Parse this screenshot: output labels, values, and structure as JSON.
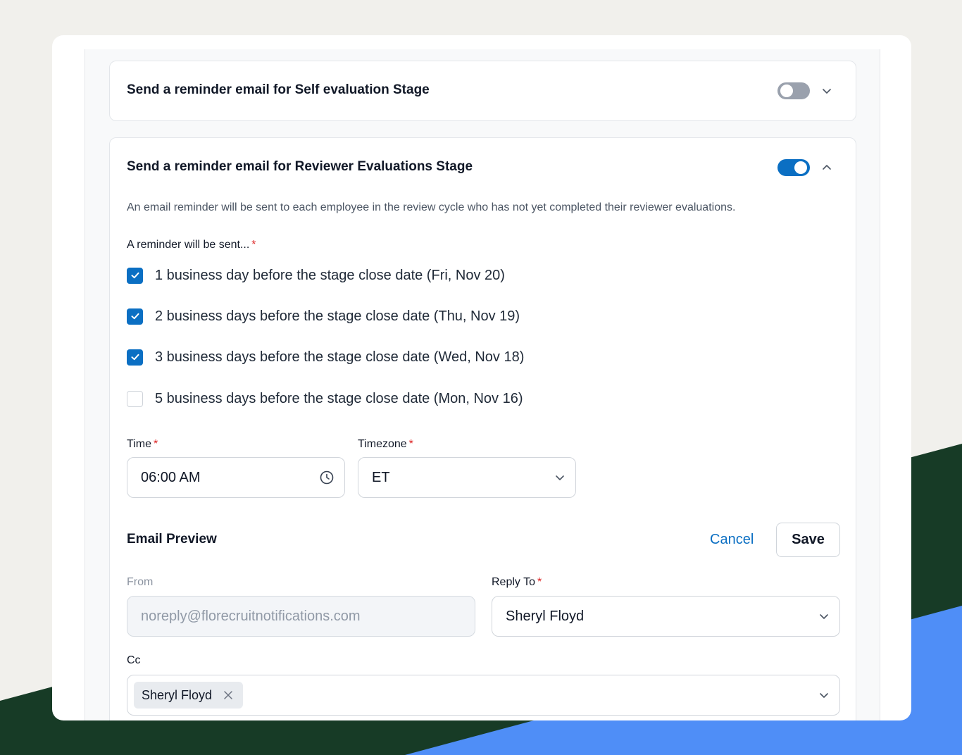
{
  "self_stage": {
    "title": "Send a reminder email for Self evaluation Stage",
    "toggle_on": false,
    "chevron_icon": "chevron-down-icon"
  },
  "reviewer_stage": {
    "title": "Send a reminder email for Reviewer Evaluations Stage",
    "toggle_on": true,
    "chevron_icon": "chevron-up-icon",
    "description": "An email reminder will be sent to each employee in the review cycle who has not yet completed their reviewer evaluations.",
    "reminder_label": "A reminder will be sent...",
    "required_mark": "*",
    "options": [
      {
        "label": "1 business day before the stage close date (Fri, Nov 20)",
        "checked": true
      },
      {
        "label": "2 business days before the stage close date (Thu, Nov 19)",
        "checked": true
      },
      {
        "label": "3 business days before the stage close date (Wed, Nov 18)",
        "checked": true
      },
      {
        "label": "5 business days before the stage close date (Mon, Nov 16)",
        "checked": false
      }
    ],
    "time": {
      "label": "Time",
      "value": "06:00 AM",
      "icon": "clock-icon"
    },
    "timezone": {
      "label": "Timezone",
      "value": "ET",
      "icon": "chevron-down-icon"
    }
  },
  "email_preview": {
    "title": "Email Preview",
    "cancel_label": "Cancel",
    "save_label": "Save",
    "from": {
      "label": "From",
      "value": "noreply@florecruitnotifications.com"
    },
    "reply_to": {
      "label": "Reply To",
      "value": "Sheryl Floyd"
    },
    "cc": {
      "label": "Cc",
      "chips": [
        "Sheryl Floyd"
      ]
    }
  },
  "colors": {
    "accent": "#0b6fc3",
    "required": "#dc2626",
    "background": "#f1f0ec",
    "decor_green": "#173b26",
    "decor_blue": "#4f8ef7"
  }
}
